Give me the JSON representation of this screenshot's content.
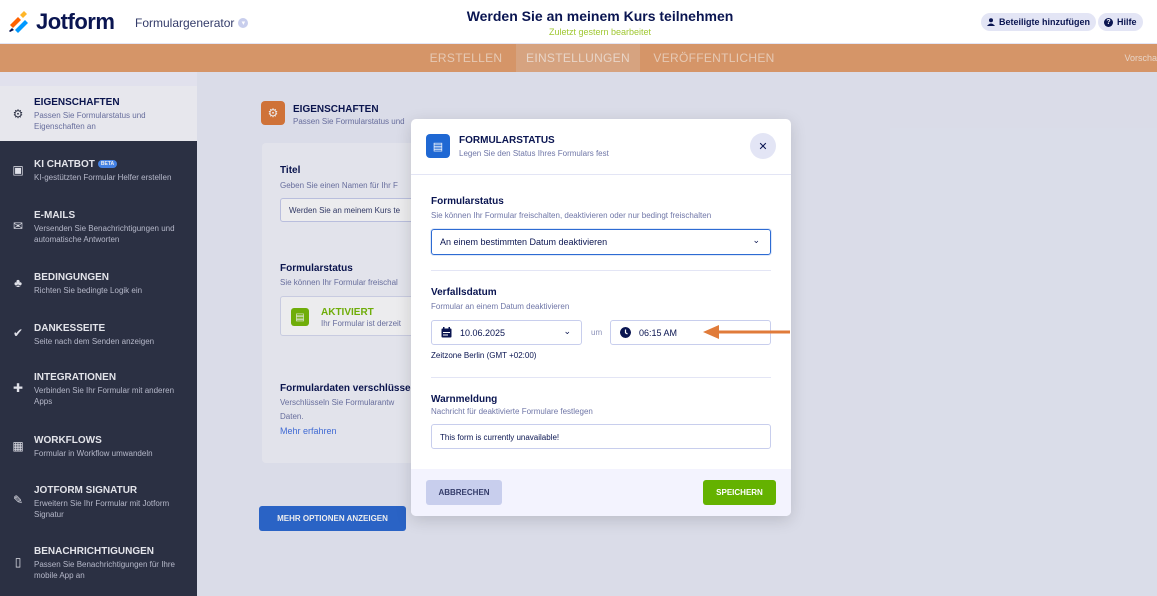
{
  "header": {
    "logo_text": "Jotform",
    "product": "Formulargenerator",
    "form_title": "Werden Sie an meinem Kurs teilnehmen",
    "form_subtitle": "Zuletzt gestern bearbeitet",
    "invite_label": "Beteiligte hinzufügen",
    "help_label": "Hilfe"
  },
  "tabs": [
    {
      "label": "ERSTELLEN"
    },
    {
      "label": "EINSTELLUNGEN"
    },
    {
      "label": "VERÖFFENTLICHEN"
    }
  ],
  "preview_label": "Vorscha",
  "sidebar": {
    "items": [
      {
        "title": "EIGENSCHAFTEN",
        "desc": "Passen Sie Formularstatus und Eigenschaften an",
        "icon": "gear-icon"
      },
      {
        "title": "KI CHATBOT",
        "badge": "BETA",
        "desc": "KI-gestützten Formular Helfer erstellen",
        "icon": "robot-icon"
      },
      {
        "title": "E-MAILS",
        "desc": "Versenden Sie Benachrichtigungen und automatische Antworten",
        "icon": "mail-icon"
      },
      {
        "title": "BEDINGUNGEN",
        "desc": "Richten Sie bedingte Logik ein",
        "icon": "people-icon"
      },
      {
        "title": "DANKESSEITE",
        "desc": "Seite nach dem Senden anzeigen",
        "icon": "check-circle-icon"
      },
      {
        "title": "INTEGRATIONEN",
        "desc": "Verbinden Sie Ihr Formular mit anderen Apps",
        "icon": "puzzle-icon"
      },
      {
        "title": "WORKFLOWS",
        "desc": "Formular in Workflow umwandeln",
        "icon": "workflow-icon"
      },
      {
        "title": "JOTFORM SIGNATUR",
        "desc": "Erweitern Sie Ihr Formular mit Jotform Signatur",
        "icon": "pen-icon"
      },
      {
        "title": "BENACHRICHTIGUNGEN",
        "desc": "Passen Sie Benachrichtigungen für Ihre mobile App an",
        "icon": "phone-icon"
      }
    ]
  },
  "background": {
    "panel_title": "EIGENSCHAFTEN",
    "panel_sub": "Passen Sie Formularstatus und",
    "title_label": "Titel",
    "title_sub": "Geben Sie einen Namen für Ihr F",
    "title_value": "Werden Sie an meinem Kurs te",
    "status_label": "Formularstatus",
    "status_sub": "Sie können Ihr Formular freischal",
    "status_value": "AKTIVIERT",
    "status_value_sub": "Ihr Formular ist derzeit",
    "encrypt_label": "Formulardaten verschlüssel",
    "encrypt_sub1": "Verschlüsseln Sie Formularantw",
    "encrypt_sub2": "Daten.",
    "learn_more": "Mehr erfahren",
    "more_options": "MEHR OPTIONEN ANZEIGEN"
  },
  "modal": {
    "title": "FORMULARSTATUS",
    "subtitle": "Legen Sie den Status Ihres Formulars fest",
    "status_label": "Formularstatus",
    "status_sub": "Sie können Ihr Formular freischalten, deaktivieren oder nur bedingt freischalten",
    "status_selected": "An einem bestimmten Datum deaktivieren",
    "expiry_label": "Verfallsdatum",
    "expiry_sub": "Formular an einem Datum deaktivieren",
    "date_value": "10.06.2025",
    "um_label": "um",
    "time_value": "06:15 AM",
    "timezone": "Zeitzone Berlin (GMT +02:00)",
    "warning_label": "Warnmeldung",
    "warning_sub": "Nachricht für deaktivierte Formulare festlegen",
    "warning_value": "This form is currently unavailable!",
    "cancel_label": "ABBRECHEN",
    "save_label": "SPEICHERN"
  },
  "colors": {
    "accent_orange": "#e6a16e",
    "save_green": "#64b200",
    "primary_blue": "#2d6bd3",
    "sidebar_dark": "#2e3346",
    "arrow": "#e07b3a"
  }
}
